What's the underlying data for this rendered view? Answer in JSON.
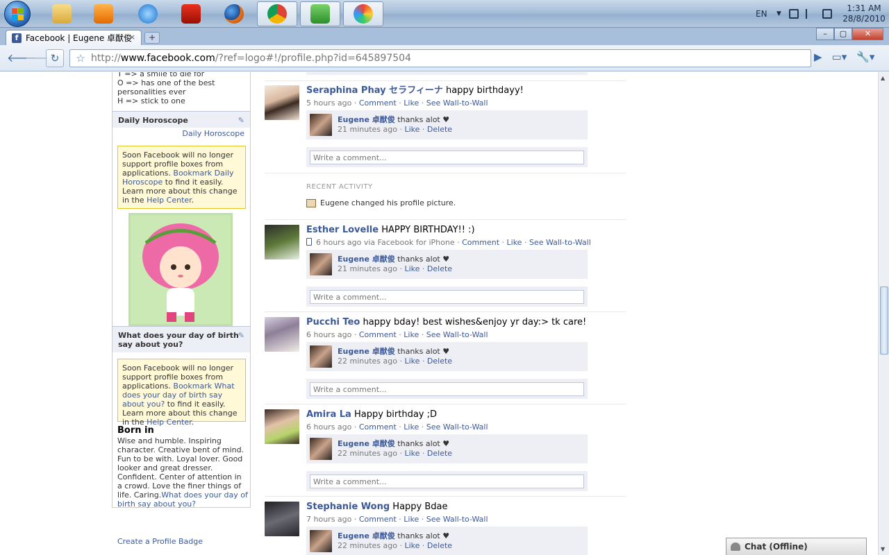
{
  "taskbar": {
    "apps": [
      "explorer-icon",
      "media-player-icon",
      "ie-icon",
      "adobe-reader-icon",
      "firefox-icon",
      "chrome-icon",
      "messenger-icon",
      "paint-icon"
    ],
    "tray": {
      "lang": "EN",
      "time": "1:31 AM",
      "date": "28/8/2010"
    }
  },
  "browser": {
    "tab_title": "Facebook | Eugene 卓猷俊",
    "tab_close": "×",
    "new_tab": "+",
    "win": {
      "min": "–",
      "max": "▢",
      "close": "✕"
    },
    "url_prefix": "http://",
    "url_domain": "www.facebook.com",
    "url_rest": "/?ref=logo#!/profile.php?id=645897504"
  },
  "sidebar": {
    "motto_lines": [
      "T => a smile to die for",
      "O => has one of the best personalities ever",
      "H => stick to one"
    ],
    "box1": {
      "title": "Daily Horoscope",
      "link": "Daily Horoscope",
      "notice_a": "Soon Facebook will no longer support profile boxes from applications. ",
      "notice_link1": "Bookmark Daily Horoscope",
      "notice_b": " to find it easily. Learn more about this change in the ",
      "notice_link2": "Help Center",
      "notice_c": "."
    },
    "box2": {
      "title": "What does your day of birth say about you?",
      "notice_a": "Soon Facebook will no longer support profile boxes from applications. ",
      "notice_link1": "Bookmark What does your day of birth say about you?",
      "notice_b": " to find it easily. Learn more about this change in the ",
      "notice_link2": "Help Center",
      "notice_c": "."
    },
    "born_title": "Born in",
    "born_text": "Wise and humble. Inspiring character. Creative bent of mind. Fun to be with. Loyal lover. Good looker and great dresser. Confident. Center of attention in a crowd. Love the finer things of life. Caring.",
    "born_link": "What does your day of birth say about you?",
    "badge": "Create a Profile Badge"
  },
  "feed": {
    "actions": {
      "comment": "Comment",
      "like": "Like",
      "wall": "See Wall-to-Wall",
      "delete": "Delete",
      "sep": " · "
    },
    "reply_author": "Eugene 卓猷俊",
    "reply_text": " thanks alot ♥",
    "comment_placeholder": "Write a comment...",
    "stories": [
      {
        "name": "Seraphina Phay セラフィーナ",
        "text": " happy birthdayy!",
        "time": "5 hours ago",
        "reply_time": "21 minutes ago"
      },
      {
        "name": "Esther Lovelle",
        "text": " HAPPY BIRTHDAY!! :)",
        "time": "6 hours ago via Facebook for iPhone",
        "reply_time": "21 minutes ago"
      },
      {
        "name": "Pucchi Teo",
        "text": " happy bday! best wishes&enjoy yr day:> tk care!",
        "time": "6 hours ago",
        "reply_time": "22 minutes ago"
      },
      {
        "name": "Amira La",
        "text": " Happy birthday ;D",
        "time": "6 hours ago",
        "reply_time": "22 minutes ago"
      },
      {
        "name": "Stephanie Wong",
        "text": " Happy Bdae",
        "time": "7 hours ago",
        "reply_time": "22 minutes ago"
      }
    ],
    "recent": {
      "heading": "RECENT ACTIVITY",
      "text": "Eugene changed his profile picture."
    }
  },
  "chat": {
    "label": "Chat (Offline)"
  }
}
